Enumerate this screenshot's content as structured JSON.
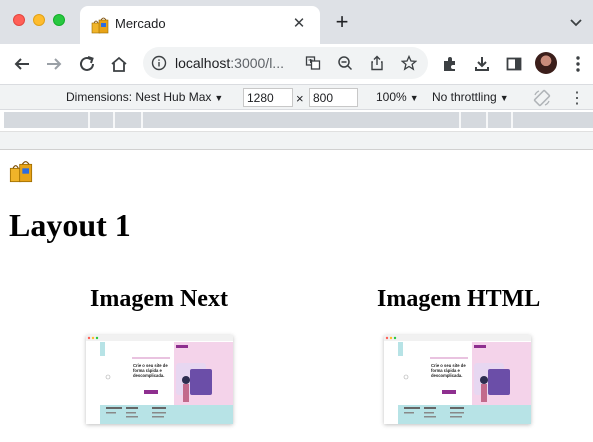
{
  "browser": {
    "tab": {
      "title": "Mercado",
      "close_glyph": "✕"
    },
    "new_tab_glyph": "+",
    "address": {
      "host": "localhost",
      "rest": ":3000/l..."
    }
  },
  "devtools": {
    "device_label": "Dimensions: Nest Hub Max",
    "width": "1280",
    "times": "×",
    "height": "800",
    "zoom": "100%",
    "throttling": "No throttling",
    "more_glyph": "⋮"
  },
  "page": {
    "title": "Layout 1",
    "images": [
      {
        "heading": "Imagem Next",
        "thumb_headline": "Crie o seu site de forma rápida e descomplicada."
      },
      {
        "heading": "Imagem HTML",
        "thumb_headline": "Crie o seu site de forma rápida e descomplicada."
      }
    ]
  },
  "icons": {
    "traffic": [
      "close-window-icon",
      "minimize-window-icon",
      "zoom-window-icon"
    ],
    "toolbar": [
      "back-icon",
      "forward-icon",
      "reload-icon",
      "home-icon",
      "extensions-icon",
      "download-icon",
      "sidebar-icon",
      "profile-avatar",
      "menu-icon"
    ],
    "omnibox": [
      "site-info-icon",
      "translate-icon",
      "zoom-out-icon",
      "share-icon",
      "bookmark-star-icon"
    ],
    "favicon": "shopping-bags-icon"
  },
  "colors": {
    "tabstrip": "#dee1e6",
    "thumb_accent_pink": "#f4d3ea",
    "thumb_accent_teal": "#b7e3e6",
    "thumb_button": "#8e2f8f"
  }
}
